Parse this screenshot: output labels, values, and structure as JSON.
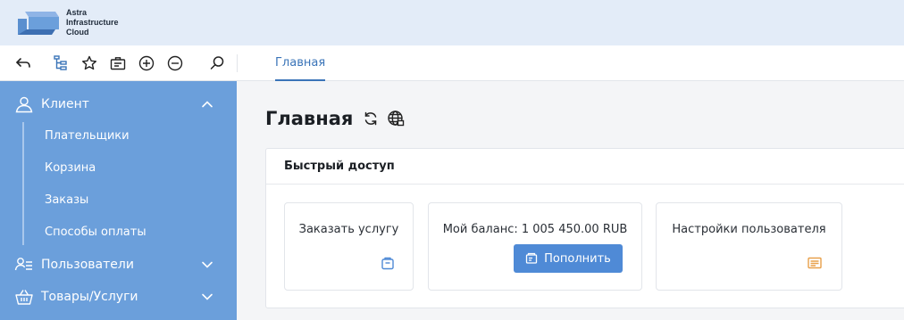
{
  "app": {
    "logo_lines": [
      "Astra",
      "Infrastructure",
      "Cloud"
    ]
  },
  "toolbar": {
    "icons": [
      "back-arrow-icon",
      "tree-icon",
      "star-icon",
      "briefcase-icon",
      "zoom-in-icon",
      "zoom-out-icon",
      "search-icon"
    ],
    "tabs": [
      {
        "label": "Главная",
        "active": true
      }
    ]
  },
  "sidebar": {
    "sections": [
      {
        "label": "Клиент",
        "icon": "user-icon",
        "expanded": true,
        "items": [
          {
            "label": "Плательщики"
          },
          {
            "label": "Корзина"
          },
          {
            "label": "Заказы"
          },
          {
            "label": "Способы оплаты"
          }
        ]
      },
      {
        "label": "Пользователи",
        "icon": "users-list-icon",
        "expanded": false
      },
      {
        "label": "Товары/Услуги",
        "icon": "basket-icon",
        "expanded": false
      }
    ]
  },
  "main": {
    "title": "Главная",
    "title_icons": [
      "refresh-icon",
      "globe-icon"
    ],
    "quick_access": {
      "title": "Быстрый доступ",
      "cards": [
        {
          "title": "Заказать услугу",
          "icon": "shopping-bag-icon"
        },
        {
          "title": "Мой баланс: 1 005 450.00 RUB",
          "button_label": "Пополнить",
          "button_icon": "wallet-icon"
        },
        {
          "title": "Настройки пользователя",
          "icon": "settings-card-icon"
        }
      ]
    }
  },
  "colors": {
    "header_bg": "#e3ecf8",
    "sidebar_bg": "#6b9fdb",
    "accent": "#3a74b8",
    "button_bg": "#4f8ad6",
    "settings_icon": "#e8a04a"
  }
}
